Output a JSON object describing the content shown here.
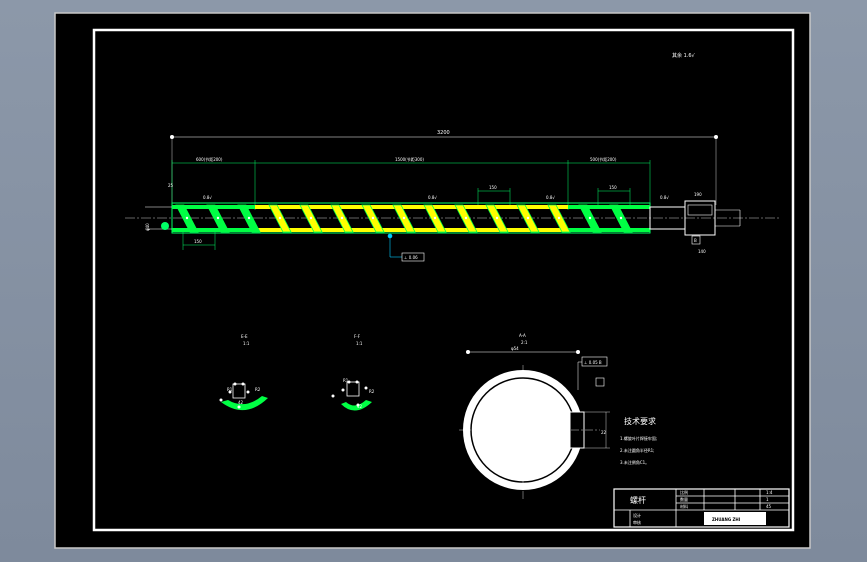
{
  "drawing": {
    "roughness_note": "其余 1.6√",
    "overall_length": "3200",
    "section_left": "600(节距200)",
    "section_middle": "1500(节距300)",
    "section_right": "500(节距200)",
    "pitch_mid": "150",
    "pitch_right": "150",
    "shaft_dim_left": "φ40",
    "dim_left_small": "25",
    "dim_150_bottom": "150",
    "dim_140_right": "140",
    "dim_190_right": "190",
    "roughness_left": "0.8√",
    "roughness_mid": "0.8√",
    "roughness_right": "0.8√",
    "roughness_end": "0.8√",
    "datum_b": "B",
    "geom_tol_mid": "⊥ 0.06",
    "section_ee_title": "E-E",
    "section_ee_scale": "1:1",
    "section_ff_title": "F-F",
    "section_ff_scale": "1:1",
    "section_aa_title": "A-A",
    "section_aa_scale": "2:1",
    "section_aa_dia": "φ54",
    "section_aa_tol": "⊥ 0.05 B",
    "section_aa_key": "22",
    "section_small_labels": [
      "R1",
      "R2",
      "42"
    ]
  },
  "tech_requirements": {
    "title": "技术要求",
    "items": [
      "1.螺旋叶片焊接牢固;",
      "2.未注圆角半径R1;",
      "3.未注倒角C1。"
    ]
  },
  "title_block": {
    "part_name": "螺杆",
    "row_labels": [
      "比例",
      "数量",
      "材料"
    ],
    "row_values": [
      "1:4",
      "1",
      "45"
    ],
    "designer_label": "设计",
    "checker_label": "审核",
    "company": "ZHUANG ZHI"
  }
}
